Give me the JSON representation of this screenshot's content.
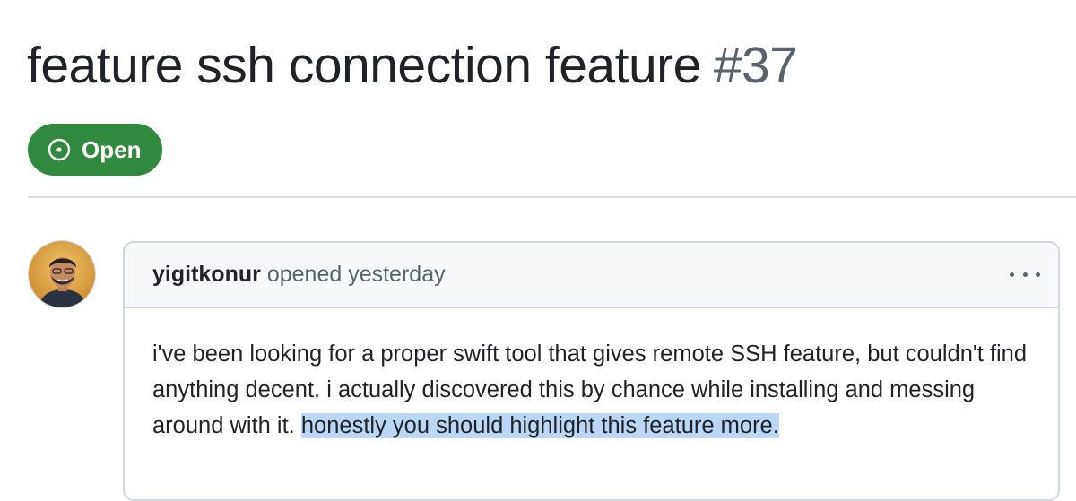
{
  "issue": {
    "title": "feature ssh connection feature",
    "number": "#37",
    "state": "Open",
    "state_color": "#2f8a3f"
  },
  "comment": {
    "author": "yigitkonur",
    "action": "opened yesterday",
    "body_plain": "i've been looking for a proper swift tool that gives remote SSH feature, but couldn't find anything decent. i actually discovered this by chance while installing and messing around with it. ",
    "body_highlighted": "honestly you should highlight this feature more."
  },
  "icons": {
    "state": "issue-opened-icon",
    "menu": "kebab-horizontal-icon"
  }
}
